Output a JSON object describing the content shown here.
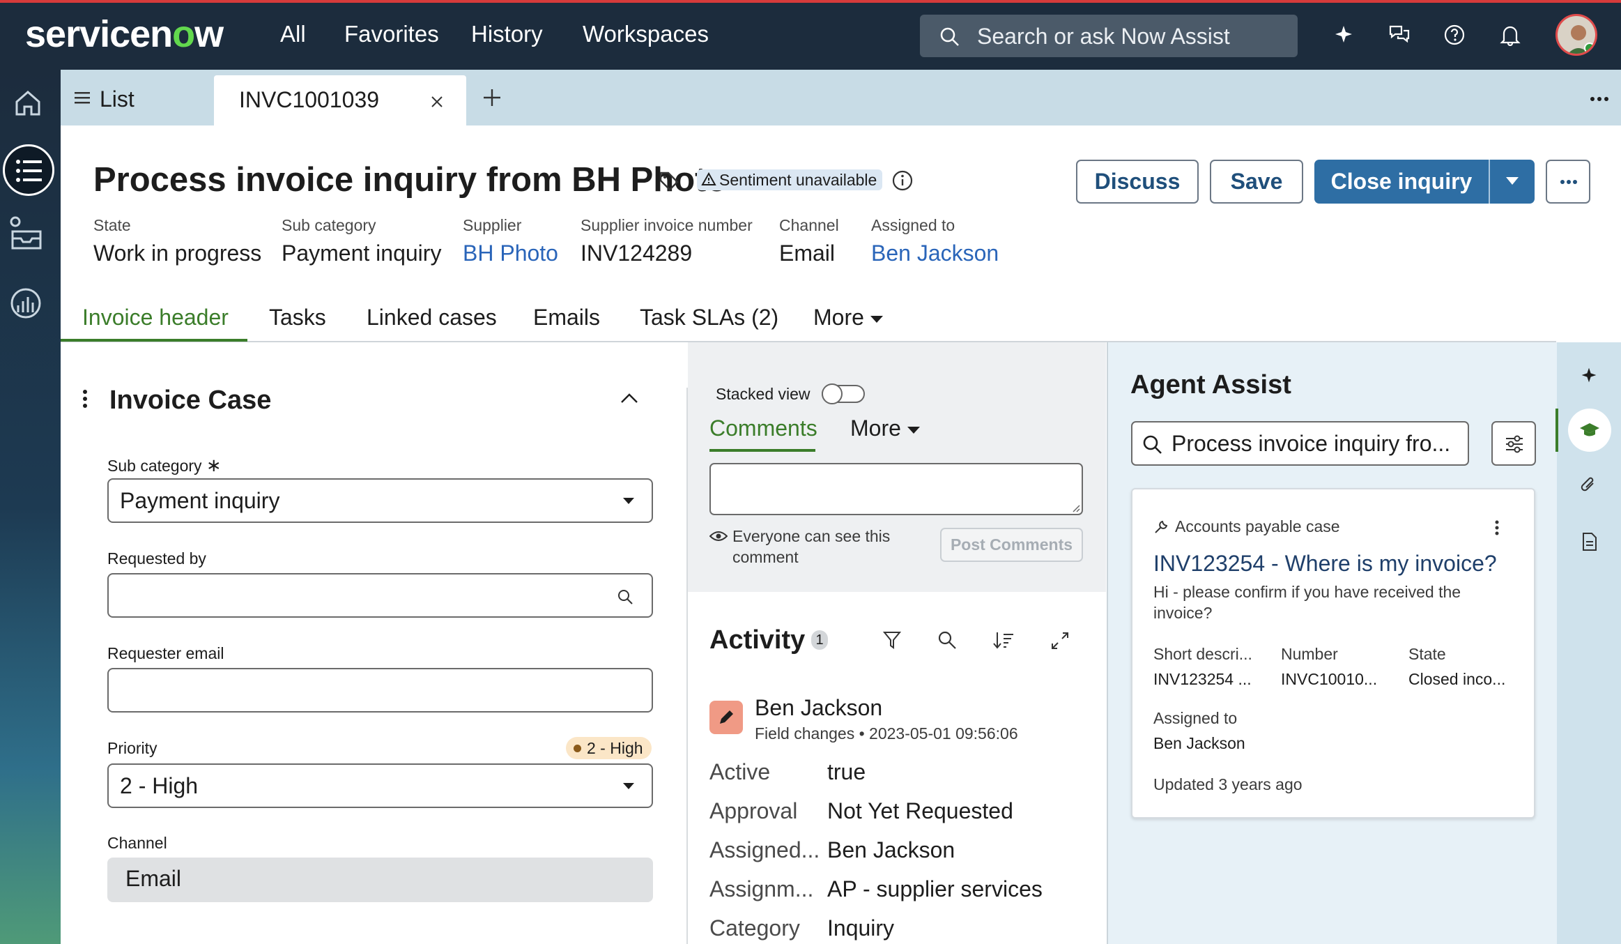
{
  "topbar": {
    "logo_main": "servicen",
    "logo_o": "o",
    "logo_end": "w",
    "nav": [
      "All",
      "Favorites",
      "History",
      "Workspaces"
    ],
    "search_placeholder": "Search or ask Now Assist"
  },
  "tabs": {
    "list_label": "List",
    "active_tab": "INVC1001039"
  },
  "record": {
    "title": "Process invoice inquiry from BH Photo",
    "sentiment": "Sentiment unavailable",
    "buttons": {
      "discuss": "Discuss",
      "save": "Save",
      "close": "Close inquiry"
    },
    "fields": [
      {
        "label": "State",
        "value": "Work in progress"
      },
      {
        "label": "Sub category",
        "value": "Payment inquiry"
      },
      {
        "label": "Supplier",
        "value": "BH Photo"
      },
      {
        "label": "Supplier invoice number",
        "value": "INV124289"
      },
      {
        "label": "Channel",
        "value": "Email"
      },
      {
        "label": "Assigned to",
        "value": "Ben Jackson"
      }
    ]
  },
  "page_tabs": [
    "Invoice header",
    "Tasks",
    "Linked cases",
    "Emails",
    "Task SLAs (2)",
    "More"
  ],
  "form": {
    "section_title": "Invoice Case",
    "sub_category_label": "Sub category",
    "sub_category_value": "Payment inquiry",
    "requested_by_label": "Requested by",
    "requester_email_label": "Requester email",
    "priority_label": "Priority",
    "priority_badge": "2 - High",
    "priority_value": "2 - High",
    "channel_label": "Channel",
    "channel_value": "Email"
  },
  "comments": {
    "stacked_view": "Stacked view",
    "tab": "Comments",
    "more": "More",
    "visibility_line1": "Everyone can see this",
    "visibility_line2": "comment",
    "post": "Post Comments"
  },
  "activity": {
    "title": "Activity",
    "count": "1",
    "author": "Ben Jackson",
    "meta": "Field changes",
    "timestamp": "2023-05-01 09:56:06",
    "changes": [
      {
        "field": "Active",
        "value": "true"
      },
      {
        "field": "Approval",
        "value": "Not Yet Requested"
      },
      {
        "field": "Assigned...",
        "value": "Ben Jackson"
      },
      {
        "field": "Assignm...",
        "value": "AP - supplier services"
      },
      {
        "field": "Category",
        "value": "Inquiry"
      }
    ]
  },
  "agent_assist": {
    "title": "Agent Assist",
    "search_value": "Process invoice inquiry fro...",
    "card": {
      "type": "Accounts payable case",
      "title": "INV123254 - Where is my invoice?",
      "body_line1": "Hi - please confirm if you have received the",
      "body_line2": "invoice?",
      "cols": [
        {
          "label": "Short descri...",
          "value": "INV123254 ..."
        },
        {
          "label": "Number",
          "value": "INVC10010..."
        },
        {
          "label": "State",
          "value": "Closed inco..."
        }
      ],
      "assigned_label": "Assigned to",
      "assigned_value": "Ben Jackson",
      "updated": "Updated 3 years ago"
    }
  },
  "colors": {
    "accent": "#2e6ea4",
    "topbar": "#1c2c3d",
    "tab_active": "#3b7d2a",
    "link": "#2a65b9"
  }
}
